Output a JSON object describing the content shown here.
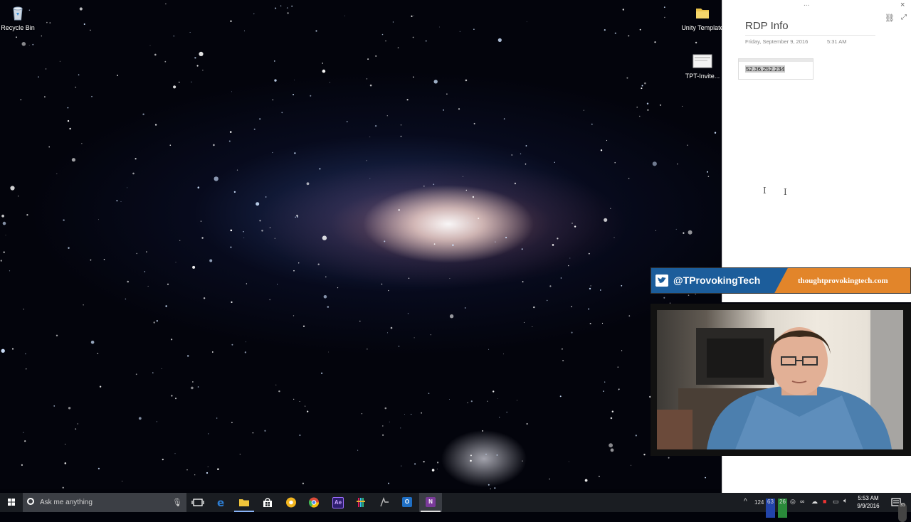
{
  "desktop": {
    "icons": [
      {
        "label": "Recycle Bin",
        "icon": "recycle-bin-icon"
      },
      {
        "label": "Unity Template",
        "icon": "folder-icon"
      },
      {
        "label": "TPT-Invite...",
        "icon": "document-icon"
      }
    ]
  },
  "onenote": {
    "title": "RDP Info",
    "date": "Friday, September 9, 2016",
    "time": "5:31 AM",
    "ip_text": "52.36.252.234",
    "dots": "...",
    "close": "×"
  },
  "banner": {
    "handle": "@TProvokingTech",
    "site": "thoughtprovokingtech.com",
    "colors": {
      "twitter_blue": "#1c5d9b",
      "orange": "#e2852a"
    }
  },
  "taskbar": {
    "search_placeholder": "Ask me anything",
    "apps": [
      {
        "name": "task-view",
        "icon": "task-view-icon"
      },
      {
        "name": "edge",
        "icon": "edge-icon",
        "color": "#2d7dd2"
      },
      {
        "name": "file-explorer",
        "icon": "folder-icon",
        "color": "#f0c43a"
      },
      {
        "name": "store",
        "icon": "store-icon",
        "color": "#ffffff"
      },
      {
        "name": "canary",
        "icon": "chrome-canary-icon",
        "color": "#f2b51f"
      },
      {
        "name": "chrome",
        "icon": "chrome-icon",
        "color": "#dd4b39"
      },
      {
        "name": "after-effects",
        "icon": "after-effects-icon",
        "color": "#2d1d6e",
        "label": "Ae"
      },
      {
        "name": "slack",
        "icon": "slack-icon",
        "color": "#4a154b"
      },
      {
        "name": "git",
        "icon": "git-icon",
        "color": "#aaaaaa"
      },
      {
        "name": "outlook",
        "icon": "outlook-icon",
        "color": "#1f6fc5",
        "label": "O"
      },
      {
        "name": "onenote",
        "icon": "onenote-icon",
        "color": "#7a3a9a",
        "label": "N"
      }
    ],
    "tray": {
      "badge1": "124",
      "badge2": "63",
      "badge3": "26",
      "time": "5:53 AM",
      "date": "9/9/2016",
      "notifications": "35"
    }
  }
}
